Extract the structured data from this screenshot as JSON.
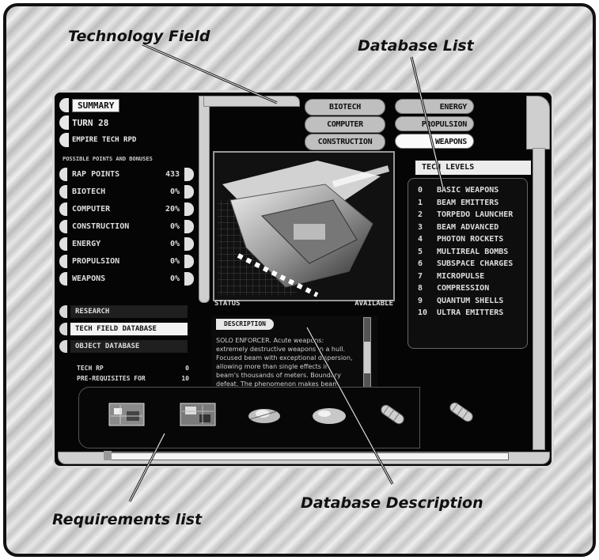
{
  "callouts": {
    "technology_field": "Technology Field",
    "database_list": "Database List",
    "database_description": "Database Description",
    "requirements_list": "Requirements list"
  },
  "summary": {
    "title": "SUMMARY",
    "turn": "TURN 28",
    "empire_tech": "EMPIRE TECH RPD"
  },
  "tech_points": {
    "header": "POSSIBLE POINTS AND BONUSES",
    "rows": [
      {
        "name": "RAP Points",
        "value": "433"
      },
      {
        "name": "BIOTECH",
        "value": "0%"
      },
      {
        "name": "COMPUTER",
        "value": "20%"
      },
      {
        "name": "CONSTRUCTION",
        "value": "0%"
      },
      {
        "name": "ENERGY",
        "value": "0%"
      },
      {
        "name": "PROPULSION",
        "value": "0%"
      },
      {
        "name": "WEAPONS",
        "value": "0%"
      }
    ]
  },
  "nav": {
    "research": "RESEARCH",
    "tech_field_database": "TECH FIELD DATABASE",
    "object_database": "OBJECT DATABASE"
  },
  "field_tabs": {
    "left": [
      "BIOTECH",
      "COMPUTER",
      "CONSTRUCTION"
    ],
    "right": [
      "ENERGY",
      "PROPULSION",
      "WEAPONS"
    ],
    "selected": "WEAPONS"
  },
  "viewer": {
    "status_label": "STATUS",
    "status_value": "AVAILABLE",
    "description_title": "DESCRIPTION",
    "description_text": "SOLO ENFORCER. Acute weapons: extremely destructive weapons in a hull. Focused beam with exceptional dispersion, allowing more than single effects in beam's thousands of meters. Boundary defeat. The phenomenon makes beam weapons."
  },
  "database": {
    "header": "TECH LEVELS",
    "items": [
      {
        "level": "0",
        "name": "BASIC WEAPONS"
      },
      {
        "level": "1",
        "name": "BEAM EMITTERS"
      },
      {
        "level": "2",
        "name": "TORPEDO LAUNCHER"
      },
      {
        "level": "3",
        "name": "BEAM ADVANCED"
      },
      {
        "level": "4",
        "name": "PHOTON ROCKETS"
      },
      {
        "level": "5",
        "name": "MULTIREAL BOMBS"
      },
      {
        "level": "6",
        "name": "SUBSPACE CHARGES"
      },
      {
        "level": "7",
        "name": "MICROPULSE"
      },
      {
        "level": "8",
        "name": "COMPRESSION"
      },
      {
        "level": "9",
        "name": "QUANTUM SHELLS"
      },
      {
        "level": "10",
        "name": "ULTRA EMITTERS"
      }
    ]
  },
  "requirements": {
    "tech_rp": "TECH RP",
    "tech_rp_value": "0",
    "pre_requisites": "PRE-REQUISITES FOR",
    "pre_requisites_value": "10"
  },
  "icons": [
    "circuit-board-icon",
    "circuit-board-icon",
    "starship-icon",
    "starship-icon",
    "torpedo-icon",
    "torpedo-icon"
  ]
}
